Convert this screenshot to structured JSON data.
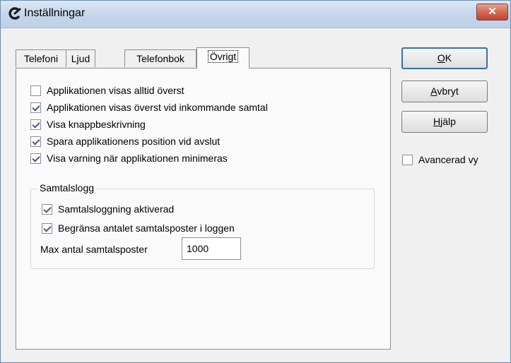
{
  "window": {
    "title": "Inställningar",
    "close_glyph": "✕",
    "app_icon": "app-logo-icon"
  },
  "tabs": [
    {
      "label": "Telefoni",
      "active": false
    },
    {
      "label": "Ljud",
      "active": false
    },
    {
      "label": "Telefonbok",
      "active": false
    },
    {
      "label": "Övrigt",
      "active": true
    }
  ],
  "options": [
    {
      "label": "Applikationen visas alltid överst",
      "checked": false
    },
    {
      "label": "Applikationen visas överst vid inkommande samtal",
      "checked": true
    },
    {
      "label": "Visa knappbeskrivning",
      "checked": true
    },
    {
      "label": "Spara applikationens position vid avslut",
      "checked": true
    },
    {
      "label": "Visa varning när applikationen minimeras",
      "checked": true
    }
  ],
  "call_log": {
    "group_label": "Samtalslogg",
    "logging_enabled_label": "Samtalsloggning aktiverad",
    "logging_enabled_checked": true,
    "limit_label": "Begränsa antalet samtalsposter i loggen",
    "limit_checked": true,
    "max_label": "Max antal samtalsposter",
    "max_value": "1000"
  },
  "buttons": {
    "ok_mnemonic": "O",
    "ok_rest": "K",
    "cancel_mnemonic": "A",
    "cancel_rest": "vbryt",
    "help_mnemonic": "H",
    "help_rest": "jälp"
  },
  "advanced_view": {
    "label": "Avancerad vy",
    "checked": false
  },
  "colors": {
    "titlebar": "#c6d6ea",
    "close_button": "#c1432c",
    "checkmark": "#3d5c8c",
    "window_bg": "#f0f0f0"
  }
}
